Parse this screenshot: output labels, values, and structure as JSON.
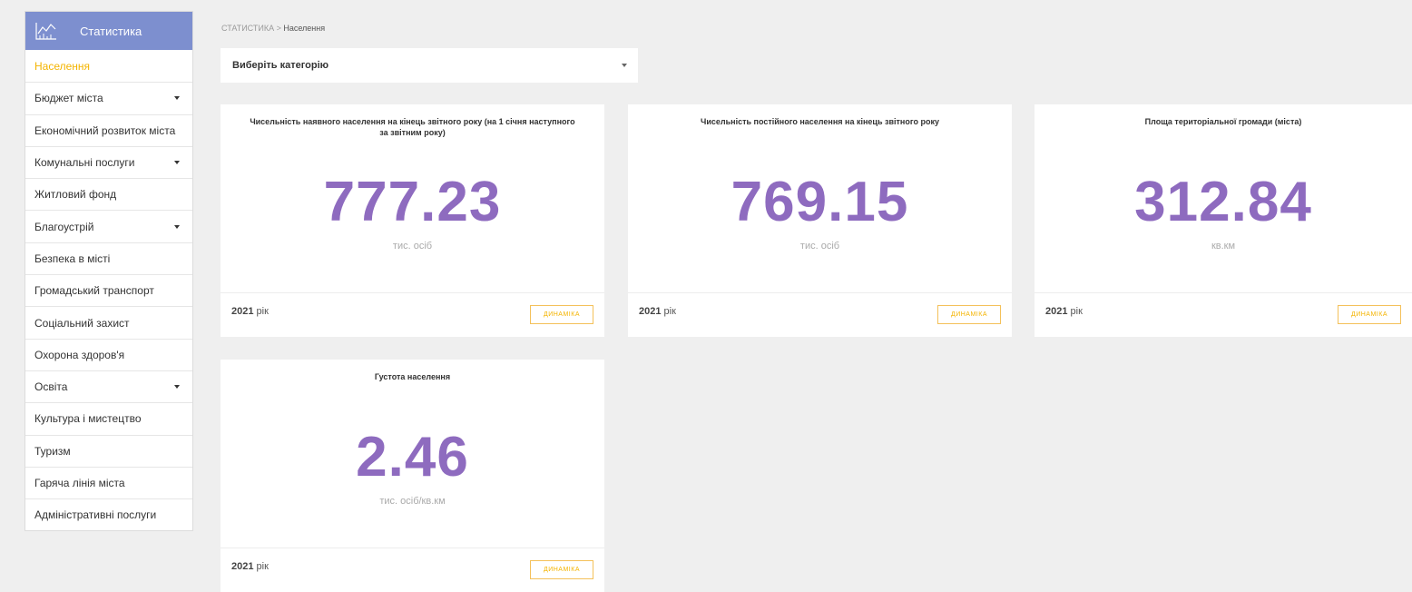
{
  "sidebar": {
    "header": "Статистика",
    "items": [
      {
        "label": "Населення",
        "active": true,
        "has_submenu": false
      },
      {
        "label": "Бюджет міста",
        "active": false,
        "has_submenu": true
      },
      {
        "label": "Економічний розвиток міста",
        "active": false,
        "has_submenu": false
      },
      {
        "label": "Комунальні послуги",
        "active": false,
        "has_submenu": true
      },
      {
        "label": "Житловий фонд",
        "active": false,
        "has_submenu": false
      },
      {
        "label": "Благоустрій",
        "active": false,
        "has_submenu": true
      },
      {
        "label": "Безпека в місті",
        "active": false,
        "has_submenu": false
      },
      {
        "label": "Громадський транспорт",
        "active": false,
        "has_submenu": false
      },
      {
        "label": "Соціальний захист",
        "active": false,
        "has_submenu": false
      },
      {
        "label": "Охорона здоров'я",
        "active": false,
        "has_submenu": false
      },
      {
        "label": "Освіта",
        "active": false,
        "has_submenu": true
      },
      {
        "label": "Культура і мистецтво",
        "active": false,
        "has_submenu": false
      },
      {
        "label": "Туризм",
        "active": false,
        "has_submenu": false
      },
      {
        "label": "Гаряча лінія міста",
        "active": false,
        "has_submenu": false
      },
      {
        "label": "Адміністративні послуги",
        "active": false,
        "has_submenu": false
      }
    ]
  },
  "breadcrumb": {
    "root": "СТАТИСТИКА",
    "separator": " > ",
    "current": "Населення"
  },
  "category_select": {
    "label": "Виберіть категорію"
  },
  "cards": [
    {
      "title": "Чисельність наявного населення на кінець звітного року (на 1 січня наступного за звітним року)",
      "value": "777.23",
      "unit": "тис. осіб",
      "year": "2021",
      "year_suffix": " рік",
      "button": "ДИНАМІКА"
    },
    {
      "title": "Чисельність постійного населення на кінець звітного року",
      "value": "769.15",
      "unit": "тис. осіб",
      "year": "2021",
      "year_suffix": " рік",
      "button": "ДИНАМІКА"
    },
    {
      "title": "Площа територіальної громади (міста)",
      "value": "312.84",
      "unit": "кв.км",
      "year": "2021",
      "year_suffix": " рік",
      "button": "ДИНАМІКА"
    },
    {
      "title": "Густота населення",
      "value": "2.46",
      "unit": "тис. осіб/кв.км",
      "year": "2021",
      "year_suffix": " рік",
      "button": "ДИНАМІКА"
    }
  ],
  "colors": {
    "header_bg": "#7d8fcf",
    "accent": "#f4b400",
    "value": "#8e6bbf"
  }
}
